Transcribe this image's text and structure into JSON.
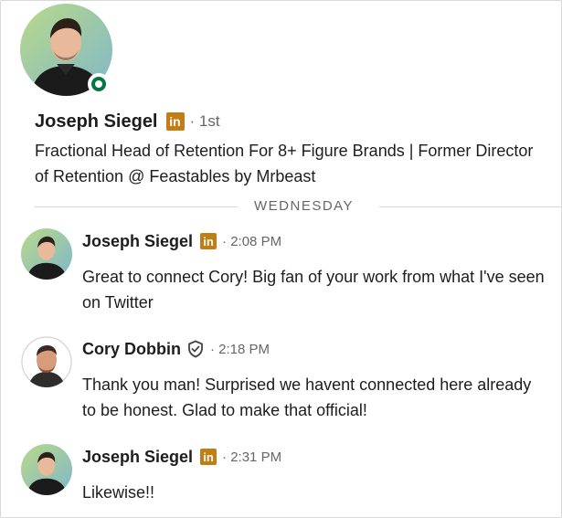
{
  "profile": {
    "name": "Joseph Siegel",
    "badge_letters": "in",
    "degree": "· 1st",
    "headline": "Fractional Head of Retention For 8+ Figure Brands | Former Director of Retention @ Feastables by Mrbeast",
    "online": true,
    "online_color": "#057642"
  },
  "divider_label": "WEDNESDAY",
  "messages": [
    {
      "sender": "Joseph Siegel",
      "badge": "in",
      "time": "· 2:08 PM",
      "text": "Great to connect Cory! Big fan of your work from what I've seen on Twitter"
    },
    {
      "sender": "Cory Dobbin",
      "verified_icon": "shield-check-icon",
      "time": "· 2:18 PM",
      "text": "Thank you man! Surprised we havent connected here already to be honest. Glad to make that official!"
    },
    {
      "sender": "Joseph Siegel",
      "badge": "in",
      "time": "· 2:31 PM",
      "text": "Likewise!!"
    }
  ],
  "colors": {
    "linkedin_premium_badge": "#c37d16",
    "text_primary": "#1d1d1d",
    "text_secondary": "#666666"
  }
}
